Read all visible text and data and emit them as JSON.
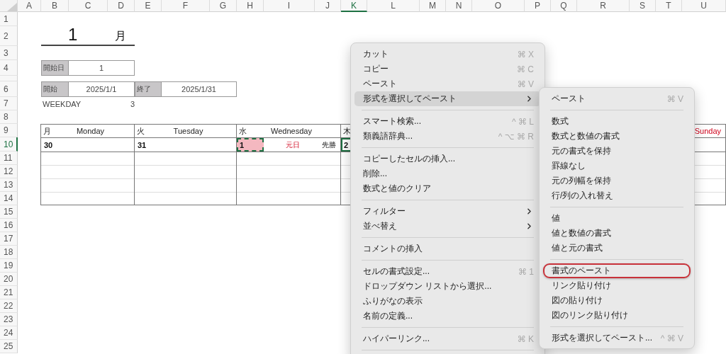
{
  "columns": [
    {
      "label": "A",
      "selected": false
    },
    {
      "label": "B",
      "selected": false
    },
    {
      "label": "C",
      "selected": false
    },
    {
      "label": "D",
      "selected": false
    },
    {
      "label": "E",
      "selected": false
    },
    {
      "label": "F",
      "selected": false
    },
    {
      "label": "G",
      "selected": false
    },
    {
      "label": "H",
      "selected": false
    },
    {
      "label": "I",
      "selected": false
    },
    {
      "label": "J",
      "selected": false
    },
    {
      "label": "K",
      "selected": true
    },
    {
      "label": "L",
      "selected": false
    },
    {
      "label": "M",
      "selected": false
    },
    {
      "label": "N",
      "selected": false
    },
    {
      "label": "O",
      "selected": false
    },
    {
      "label": "P",
      "selected": false
    },
    {
      "label": "Q",
      "selected": false
    },
    {
      "label": "R",
      "selected": false
    },
    {
      "label": "S",
      "selected": false
    },
    {
      "label": "T",
      "selected": false
    },
    {
      "label": "U",
      "selected": false
    }
  ],
  "rows": [
    {
      "label": "1",
      "selected": false
    },
    {
      "label": "2",
      "selected": false
    },
    {
      "label": "3",
      "selected": false
    },
    {
      "label": "4",
      "selected": false
    },
    {
      "selected": false
    },
    {
      "label": "6",
      "selected": false
    },
    {
      "label": "7",
      "selected": false
    },
    {
      "label": "8",
      "selected": false
    },
    {
      "label": "9",
      "selected": false
    },
    {
      "label": "10",
      "selected": true
    },
    {
      "label": "11",
      "selected": false
    },
    {
      "label": "12",
      "selected": false
    },
    {
      "label": "13",
      "selected": false
    },
    {
      "label": "14",
      "selected": false
    },
    {
      "label": "15",
      "selected": false
    },
    {
      "label": "16",
      "selected": false
    },
    {
      "label": "17",
      "selected": false
    },
    {
      "label": "18",
      "selected": false
    },
    {
      "label": "19",
      "selected": false
    },
    {
      "label": "20",
      "selected": false
    },
    {
      "label": "21",
      "selected": false
    },
    {
      "label": "22",
      "selected": false
    },
    {
      "label": "23",
      "selected": false
    },
    {
      "label": "24",
      "selected": false
    },
    {
      "label": "25",
      "selected": false
    }
  ],
  "sheet": {
    "month_number": "1",
    "month_suffix": "月",
    "start_day": {
      "label": "開始日",
      "value": "1"
    },
    "period": {
      "start_label": "開始",
      "start_value": "2025/1/1",
      "end_label": "終了",
      "end_value": "2025/1/31"
    },
    "weekday": {
      "label": "WEEKDAY",
      "value": "3"
    }
  },
  "calendar": {
    "headers": [
      {
        "kanji": "月",
        "day": "Monday"
      },
      {
        "kanji": "火",
        "day": "Tuesday"
      },
      {
        "kanji": "水",
        "day": "Wednesday"
      },
      {
        "kanji": "木"
      },
      {
        "day": "Sunday",
        "color": "#d0021b"
      }
    ],
    "dates": [
      {
        "date": "30",
        "highlighted": false,
        "copied": false,
        "active": false
      },
      {
        "date": "31",
        "highlighted": false,
        "copied": false,
        "active": false
      },
      {
        "date": "1",
        "holiday": "元日",
        "rokuyo": "先勝",
        "highlighted": true,
        "copied": true,
        "active": false
      },
      {
        "date": "2",
        "highlighted": false,
        "copied": false,
        "active": true
      }
    ]
  },
  "context_menu": {
    "items": [
      {
        "kind": "item",
        "label": "カット",
        "shortcut": "⌘ X",
        "submenu": false,
        "selected": false
      },
      {
        "kind": "item",
        "label": "コピー",
        "shortcut": "⌘ C",
        "submenu": false,
        "selected": false
      },
      {
        "kind": "item",
        "label": "ペースト",
        "shortcut": "⌘ V",
        "submenu": false,
        "selected": false
      },
      {
        "kind": "item",
        "label": "形式を選択してペースト",
        "submenu": true,
        "selected": true
      },
      {
        "kind": "separator"
      },
      {
        "kind": "item",
        "label": "スマート検索...",
        "shortcut": "^ ⌘ L",
        "submenu": false,
        "selected": false
      },
      {
        "kind": "item",
        "label": "類義語辞典...",
        "shortcut": "^ ⌥ ⌘ R",
        "submenu": false,
        "selected": false
      },
      {
        "kind": "separator"
      },
      {
        "kind": "item",
        "label": "コピーしたセルの挿入...",
        "submenu": false,
        "selected": false
      },
      {
        "kind": "item",
        "label": "削除...",
        "submenu": false,
        "selected": false
      },
      {
        "kind": "item",
        "label": "数式と値のクリア",
        "submenu": false,
        "selected": false
      },
      {
        "kind": "separator"
      },
      {
        "kind": "item",
        "label": "フィルター",
        "submenu": true,
        "selected": false
      },
      {
        "kind": "item",
        "label": "並べ替え",
        "submenu": true,
        "selected": false
      },
      {
        "kind": "separator"
      },
      {
        "kind": "item",
        "label": "コメントの挿入",
        "submenu": false,
        "selected": false
      },
      {
        "kind": "separator"
      },
      {
        "kind": "item",
        "label": "セルの書式設定...",
        "shortcut": "⌘ 1",
        "submenu": false,
        "selected": false
      },
      {
        "kind": "item",
        "label": "ドロップダウン リストから選択...",
        "submenu": false,
        "selected": false
      },
      {
        "kind": "item",
        "label": "ふりがなの表示",
        "submenu": false,
        "selected": false
      },
      {
        "kind": "item",
        "label": "名前の定義...",
        "submenu": false,
        "selected": false
      },
      {
        "kind": "separator"
      },
      {
        "kind": "item",
        "label": "ハイパーリンク...",
        "shortcut": "⌘ K",
        "submenu": false,
        "selected": false
      },
      {
        "kind": "separator"
      }
    ]
  },
  "paste_submenu": {
    "items": [
      {
        "kind": "item",
        "label": "ペースト",
        "shortcut": "⌘ V",
        "circled": false
      },
      {
        "kind": "separator"
      },
      {
        "kind": "item",
        "label": "数式",
        "circled": false
      },
      {
        "kind": "item",
        "label": "数式と数値の書式",
        "circled": false
      },
      {
        "kind": "item",
        "label": "元の書式を保持",
        "circled": false
      },
      {
        "kind": "item",
        "label": "罫線なし",
        "circled": false
      },
      {
        "kind": "item",
        "label": "元の列幅を保持",
        "circled": false
      },
      {
        "kind": "item",
        "label": "行/列の入れ替え",
        "circled": false
      },
      {
        "kind": "separator"
      },
      {
        "kind": "item",
        "label": "値",
        "circled": false
      },
      {
        "kind": "item",
        "label": "値と数値の書式",
        "circled": false
      },
      {
        "kind": "item",
        "label": "値と元の書式",
        "circled": false
      },
      {
        "kind": "separator"
      },
      {
        "kind": "item",
        "label": "書式のペースト",
        "circled": true
      },
      {
        "kind": "item",
        "label": "リンク貼り付け",
        "circled": false
      },
      {
        "kind": "item",
        "label": "図の貼り付け",
        "circled": false
      },
      {
        "kind": "item",
        "label": "図のリンク貼り付け",
        "circled": false
      },
      {
        "kind": "separator"
      },
      {
        "kind": "item",
        "label": "形式を選択してペースト...",
        "shortcut": "^ ⌘ V",
        "circled": false
      }
    ]
  }
}
